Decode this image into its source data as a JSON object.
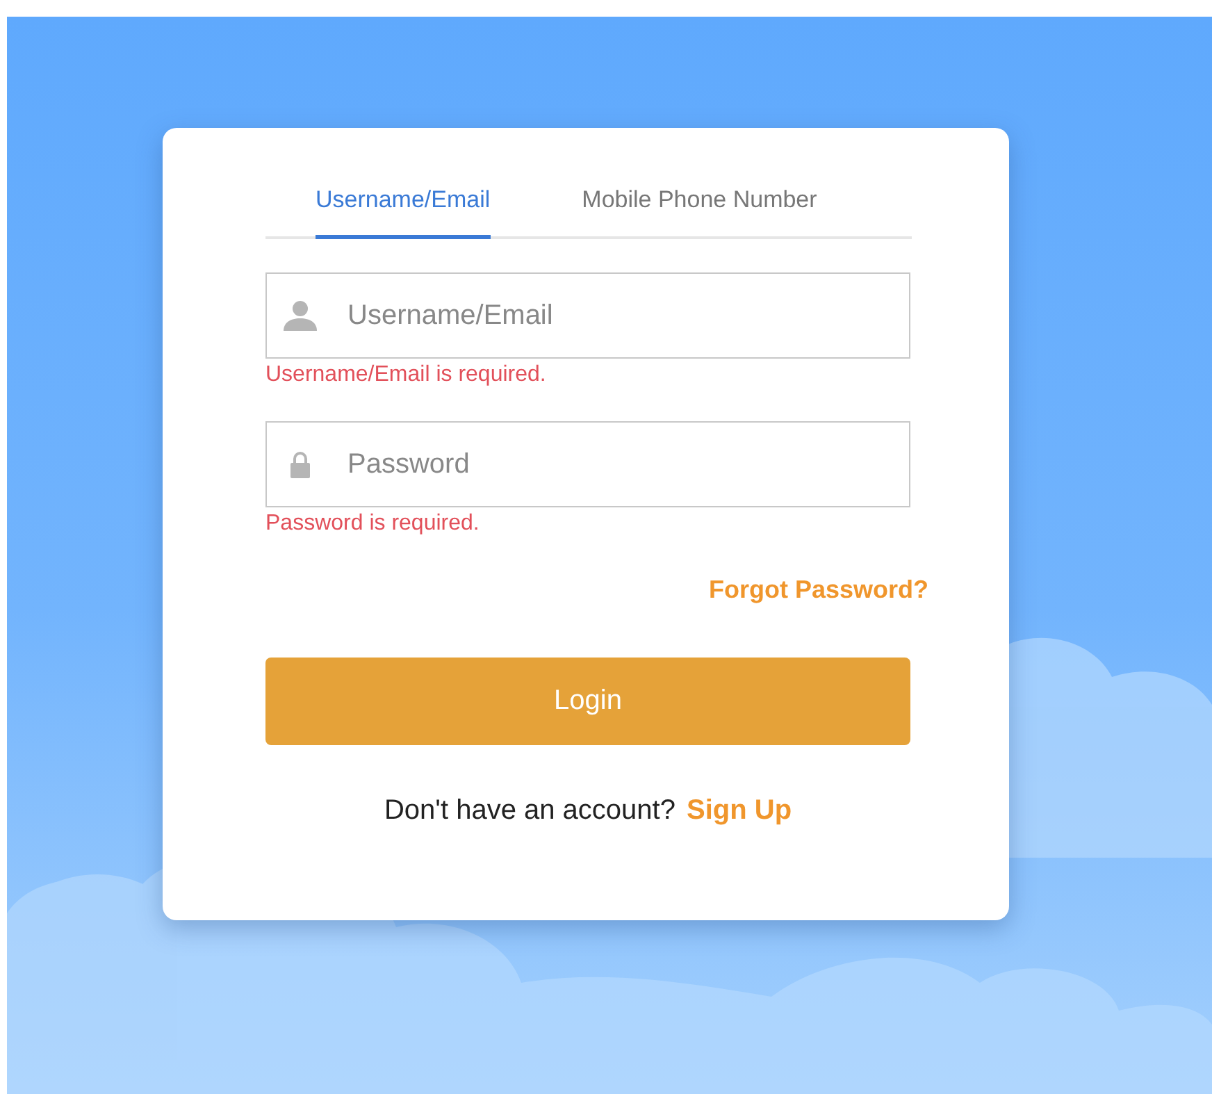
{
  "tabs": [
    {
      "label": "Username/Email",
      "selected": true
    },
    {
      "label": "Mobile Phone Number",
      "selected": false
    }
  ],
  "fields": [
    {
      "kind": "user",
      "placeholder": "Username/Email",
      "error": "Username/Email is required."
    },
    {
      "kind": "password",
      "placeholder": "Password",
      "error": "Password is required."
    }
  ],
  "forgot_link": "Forgot Password?",
  "login_button": "Login",
  "signup": {
    "prompt": "Don't have an account?",
    "link": "Sign Up"
  }
}
